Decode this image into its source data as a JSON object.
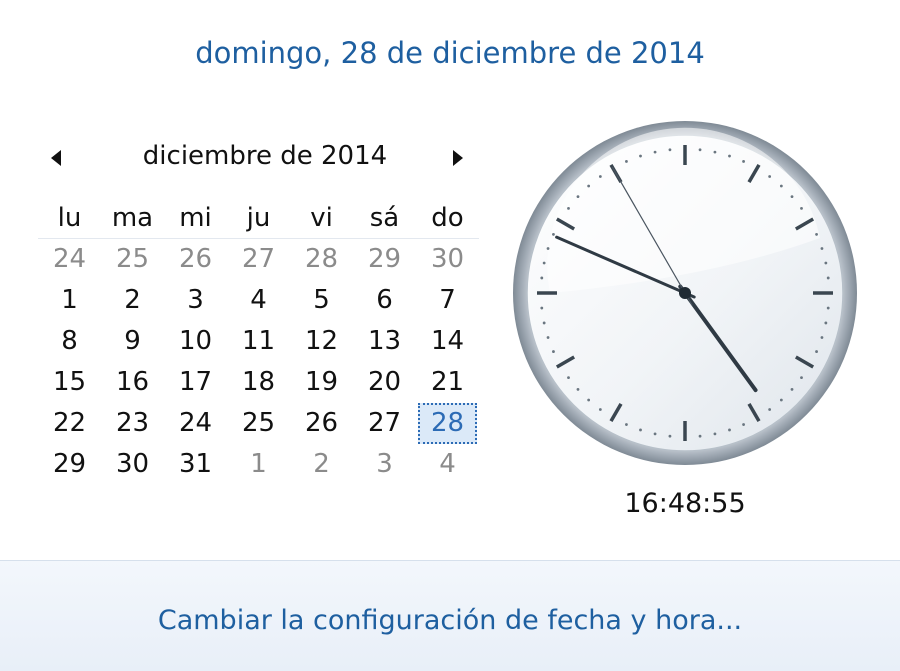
{
  "header": {
    "full_date": "domingo, 28 de diciembre de 2014"
  },
  "calendar": {
    "month_title": "diciembre de 2014",
    "prev_icon": "triangle-left-icon",
    "next_icon": "triangle-right-icon",
    "weekdays": [
      "lu",
      "ma",
      "mi",
      "ju",
      "vi",
      "sá",
      "do"
    ],
    "weeks": [
      [
        {
          "d": "24",
          "o": true
        },
        {
          "d": "25",
          "o": true
        },
        {
          "d": "26",
          "o": true
        },
        {
          "d": "27",
          "o": true
        },
        {
          "d": "28",
          "o": true
        },
        {
          "d": "29",
          "o": true
        },
        {
          "d": "30",
          "o": true
        }
      ],
      [
        {
          "d": "1"
        },
        {
          "d": "2"
        },
        {
          "d": "3"
        },
        {
          "d": "4"
        },
        {
          "d": "5"
        },
        {
          "d": "6"
        },
        {
          "d": "7"
        }
      ],
      [
        {
          "d": "8"
        },
        {
          "d": "9"
        },
        {
          "d": "10"
        },
        {
          "d": "11"
        },
        {
          "d": "12"
        },
        {
          "d": "13"
        },
        {
          "d": "14"
        }
      ],
      [
        {
          "d": "15"
        },
        {
          "d": "16"
        },
        {
          "d": "17"
        },
        {
          "d": "18"
        },
        {
          "d": "19"
        },
        {
          "d": "20"
        },
        {
          "d": "21"
        }
      ],
      [
        {
          "d": "22"
        },
        {
          "d": "23"
        },
        {
          "d": "24"
        },
        {
          "d": "25"
        },
        {
          "d": "26"
        },
        {
          "d": "27"
        },
        {
          "d": "28",
          "today": true
        }
      ],
      [
        {
          "d": "29"
        },
        {
          "d": "30"
        },
        {
          "d": "31"
        },
        {
          "d": "1",
          "o": true
        },
        {
          "d": "2",
          "o": true
        },
        {
          "d": "3",
          "o": true
        },
        {
          "d": "4",
          "o": true
        }
      ]
    ],
    "colors": {
      "link": "#1e5fa0",
      "today": "#2c6bb5",
      "other_month": "#8b8b8b"
    }
  },
  "clock": {
    "time_text": "16:48:55",
    "hour": 16,
    "minute": 48,
    "second": 55
  },
  "footer": {
    "link_text": "Cambiar la configuración de fecha y hora..."
  }
}
